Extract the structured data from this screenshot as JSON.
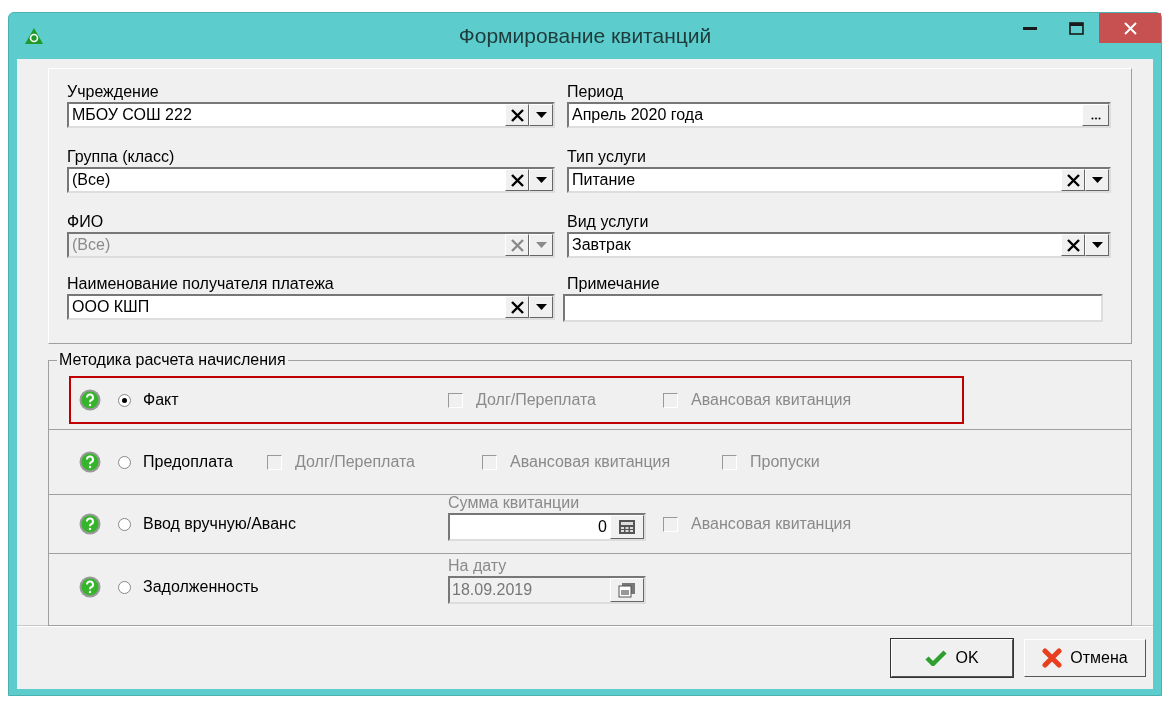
{
  "window": {
    "title": "Формирование квитанций"
  },
  "fields_left": [
    {
      "label": "Учреждение",
      "value": "МБОУ СОШ 222",
      "kind": "combo",
      "disabled": false
    },
    {
      "label": "Группа (класс)",
      "value": "(Все)",
      "kind": "combo",
      "disabled": false
    },
    {
      "label": "ФИО",
      "value": "(Все)",
      "kind": "combo",
      "disabled": true
    },
    {
      "label": "Наименование получателя платежа",
      "value": "ООО КШП",
      "kind": "combo",
      "disabled": false
    }
  ],
  "fields_right": [
    {
      "label": "Период",
      "value": "Апрель 2020 года",
      "kind": "ellipsis"
    },
    {
      "label": "Тип услуги",
      "value": "Питание",
      "kind": "combo",
      "disabled": false
    },
    {
      "label": "Вид услуги",
      "value": "Завтрак",
      "kind": "combo",
      "disabled": false
    },
    {
      "label": "Примечание",
      "kind": "text"
    }
  ],
  "method": {
    "title": "Методика расчета начисления",
    "rows": [
      {
        "label": "Факт",
        "selected": true,
        "highlighted": true,
        "options": [
          {
            "kind": "checkbox",
            "label": "Долг/Переплата",
            "checked": false,
            "disabled": true
          },
          {
            "kind": "checkbox",
            "label": "Авансовая квитанция",
            "checked": false,
            "disabled": true
          }
        ]
      },
      {
        "label": "Предоплата",
        "selected": false,
        "highlighted": false,
        "options": [
          {
            "kind": "checkbox",
            "label": "Долг/Переплата",
            "checked": false,
            "disabled": true
          },
          {
            "kind": "checkbox",
            "label": "Авансовая квитанция",
            "checked": false,
            "disabled": true
          },
          {
            "kind": "checkbox",
            "label": "Пропуски",
            "checked": false,
            "disabled": true
          }
        ]
      },
      {
        "label": "Ввод вручную/Аванс",
        "selected": false,
        "highlighted": false,
        "options": [
          {
            "kind": "number",
            "label": "Сумма квитанции",
            "value": "0"
          },
          {
            "kind": "checkbox",
            "label": "Авансовая квитанция",
            "checked": false,
            "disabled": true
          }
        ]
      },
      {
        "label": "Задолженность",
        "selected": false,
        "highlighted": false,
        "options": [
          {
            "kind": "date",
            "label": "На дату",
            "value": "18.09.2019",
            "disabled": true
          }
        ]
      }
    ]
  },
  "buttons": [
    {
      "kind": "ok",
      "label": "OK"
    },
    {
      "kind": "cancel",
      "label": "Отмена"
    }
  ]
}
